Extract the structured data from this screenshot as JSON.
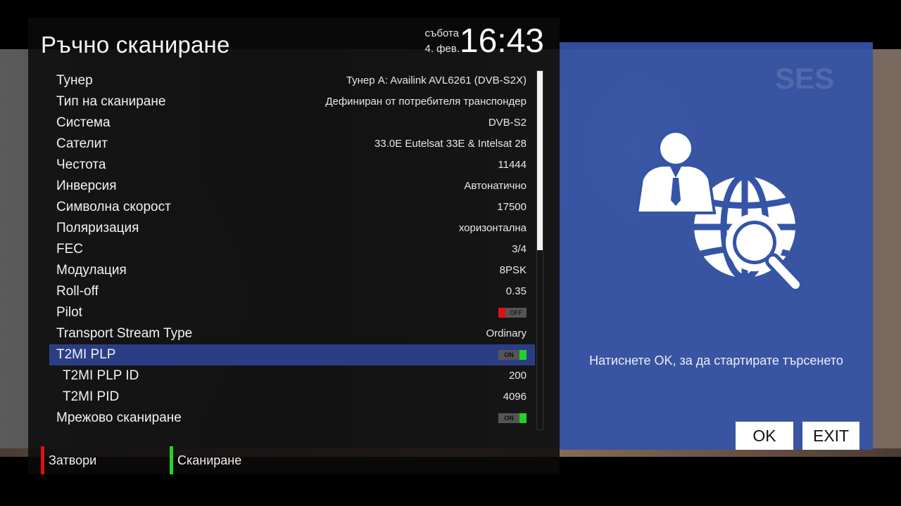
{
  "screen": {
    "title": "Ръчно сканиране",
    "date_day": "събота",
    "date": "4. фев.",
    "time": "16:43"
  },
  "settings": [
    {
      "label": "Тунер",
      "value": "Тунер A: Availink AVL6261 (DVB-S2X)"
    },
    {
      "label": "Тип на сканиране",
      "value": "Дефиниран от потребителя транспондер"
    },
    {
      "label": "Система",
      "value": "DVB-S2"
    },
    {
      "label": "Сателит",
      "value": "33.0E Eutelsat 33E & Intelsat 28"
    },
    {
      "label": "Честота",
      "value": "11444"
    },
    {
      "label": "Инверсия",
      "value": "Автонатично"
    },
    {
      "label": "Символна скорост",
      "value": "17500"
    },
    {
      "label": "Поляризация",
      "value": "хоризонтална"
    },
    {
      "label": "FEC",
      "value": "3/4"
    },
    {
      "label": "Модулация",
      "value": "8PSK"
    },
    {
      "label": "Roll-off",
      "value": "0.35"
    },
    {
      "label": "Pilot",
      "toggle": "OFF"
    },
    {
      "label": "Transport Stream Type",
      "value": "Ordinary"
    },
    {
      "label": "T2MI PLP",
      "toggle": "ON",
      "selected": true
    },
    {
      "label": "T2MI PLP ID",
      "value": "200",
      "sub": true
    },
    {
      "label": "T2MI PID",
      "value": "4096",
      "sub": true
    },
    {
      "label": "Мрежово сканиране",
      "toggle": "ON"
    }
  ],
  "footer": {
    "red_label": "Затвори",
    "green_label": "Сканиране",
    "red_color": "#e01010",
    "green_color": "#22d22a"
  },
  "info_panel": {
    "icon": "user-globe-search-icon",
    "message": "Натиснете OK, за да стартирате търсенето",
    "ok_label": "OK",
    "exit_label": "EXIT",
    "background_color": "#3454a8",
    "watermark": "SES"
  },
  "colors": {
    "selected_row": "#2b3e85"
  }
}
